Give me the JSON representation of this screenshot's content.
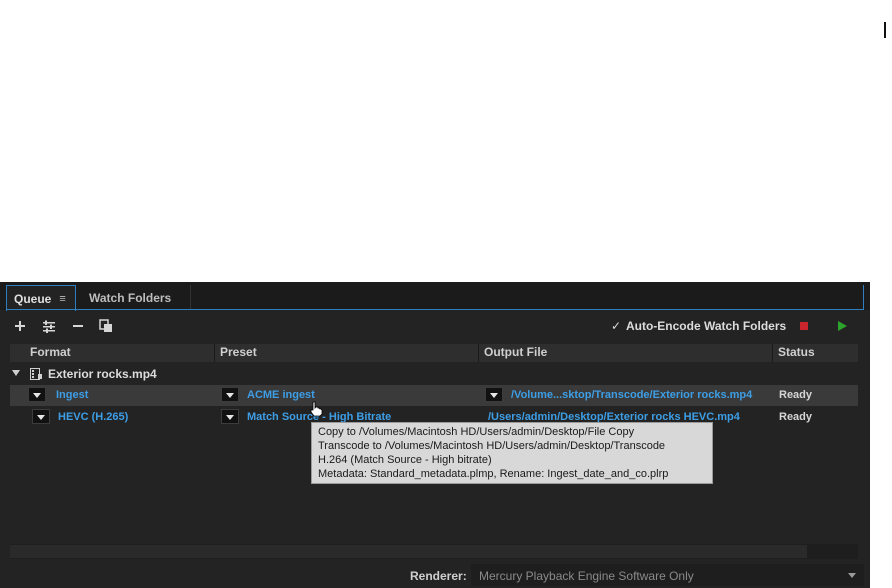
{
  "tabs": {
    "queue_label": "Queue",
    "watch_folders_label": "Watch Folders"
  },
  "toolbar": {
    "auto_encode_label": "Auto-Encode Watch Folders",
    "auto_encode_checked": true,
    "icons": [
      "add-icon",
      "preset-settings-icon",
      "remove-icon",
      "duplicate-icon",
      "stop-icon",
      "play-icon"
    ],
    "colors": {
      "stop": "#c8262c",
      "start": "#2ca32c"
    }
  },
  "columns": [
    "Format",
    "Preset",
    "Output File",
    "Status"
  ],
  "queue": {
    "source_file": "Exterior rocks.mp4",
    "rows": [
      {
        "format": "Ingest",
        "preset": "ACME ingest",
        "output": "/Volume...sktop/Transcode/Exterior rocks.mp4",
        "status": "Ready"
      },
      {
        "format": "HEVC (H.265)",
        "preset": "Match Source - High Bitrate",
        "output": "/Users/admin/Desktop/Exterior rocks HEVC.mp4",
        "status": "Ready"
      }
    ]
  },
  "tooltip": {
    "lines": [
      "Copy to /Volumes/Macintosh HD/Users/admin/Desktop/File Copy",
      "Transcode to /Volumes/Macintosh HD/Users/admin/Desktop/Transcode",
      "H.264 (Match Source - High bitrate)",
      "Metadata: Standard_metadata.plmp, Rename: Ingest_date_and_co.plrp"
    ]
  },
  "footer": {
    "renderer_label": "Renderer:",
    "renderer_value": "Mercury Playback Engine Software Only"
  },
  "accent_color": "#3d9ee6"
}
